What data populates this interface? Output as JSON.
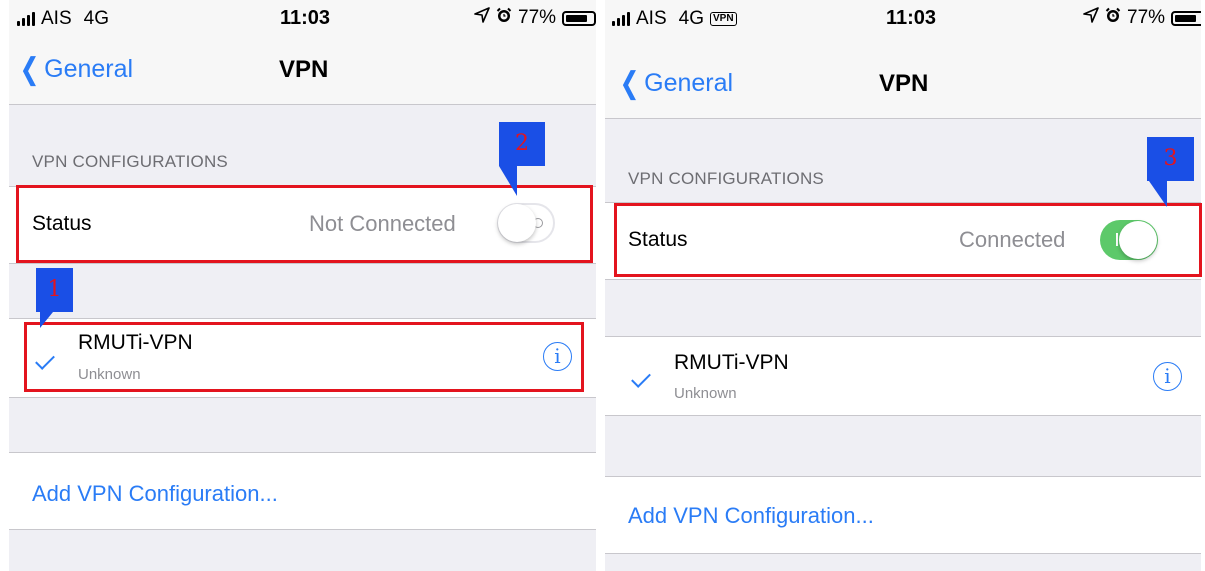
{
  "statusbar": {
    "carrier": "AIS",
    "network": "4G",
    "vpn_badge": "VPN",
    "time": "11:03",
    "battery": "77%"
  },
  "nav": {
    "back_label": "General",
    "title": "VPN"
  },
  "section": {
    "header": "VPN CONFIGURATIONS"
  },
  "left": {
    "status_label": "Status",
    "status_value": "Not Connected",
    "toggle_on": false
  },
  "right": {
    "status_label": "Status",
    "status_value": "Connected",
    "toggle_on": true
  },
  "vpn_item": {
    "name": "RMUTi-VPN",
    "subtitle": "Unknown",
    "info_glyph": "i"
  },
  "add_vpn_label": "Add VPN Configuration...",
  "callouts": {
    "one": "1",
    "two": "2",
    "three": "3"
  },
  "colors": {
    "ios_blue": "#2a7cf6",
    "toggle_green": "#5dc96a",
    "highlight_red": "#e3141e",
    "callout_blue": "#1a4fe6",
    "background_gray": "#efeff4"
  },
  "icons": {
    "signal": "signal-bars-icon",
    "location": "location-arrow-icon",
    "alarm": "alarm-clock-icon",
    "battery": "battery-icon",
    "back": "chevron-left-icon",
    "check": "checkmark-icon",
    "info": "info-icon"
  }
}
